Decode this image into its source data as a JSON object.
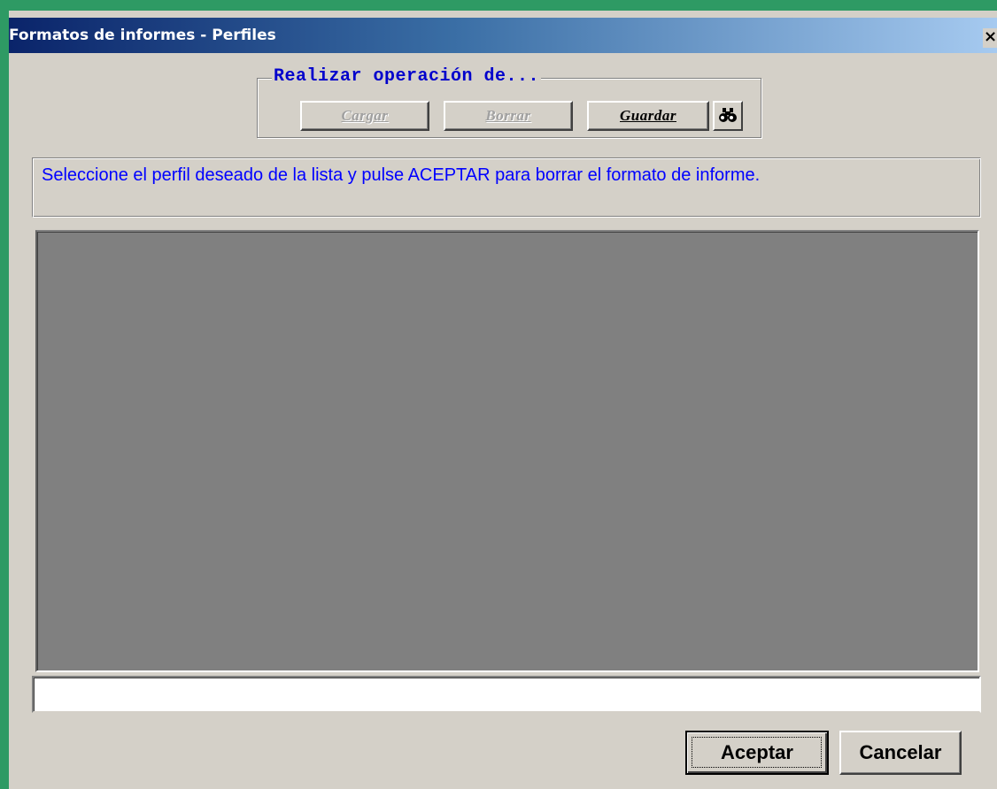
{
  "window": {
    "title": "Formatos de informes - Perfiles",
    "close_label": "×"
  },
  "operation_group": {
    "legend": "Realizar operación de...",
    "buttons": [
      {
        "label": "Cargar",
        "enabled": false
      },
      {
        "label": "Borrar",
        "enabled": false
      },
      {
        "label": "Guardar",
        "enabled": true
      }
    ],
    "search_icon": "binoculars-icon"
  },
  "message": {
    "text": "Seleccione el perfil deseado de la lista y pulse ACEPTAR para borrar el formato de informe."
  },
  "profile_list": {
    "items": []
  },
  "profile_name_input": {
    "value": ""
  },
  "footer": {
    "accept_label": "Aceptar",
    "cancel_label": "Cancelar"
  },
  "colors": {
    "desktop": "#2e9a64",
    "window_face": "#d4d0c8",
    "title_start": "#0a246a",
    "title_end": "#a6caf0",
    "legend_text": "#0000cc",
    "message_text": "#0000ff",
    "list_background": "#808080"
  }
}
